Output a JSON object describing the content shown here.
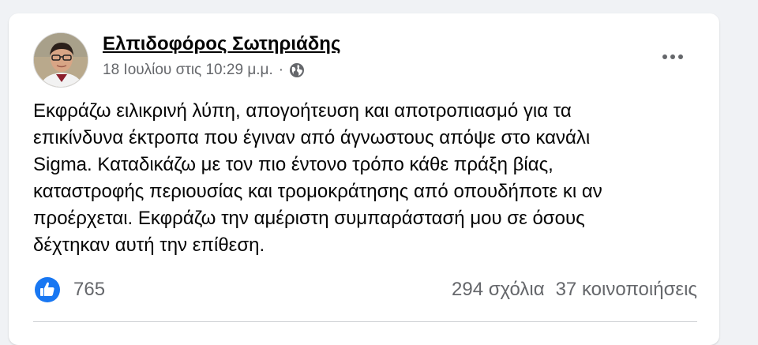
{
  "post": {
    "author": "Ελπιδοφόρος Σωτηριάδης",
    "timestamp": "18 Ιουλίου στις 10:29 μ.μ.",
    "separator": "·",
    "privacy_icon": "globe-icon",
    "more_icon": "more-options-icon",
    "text_lines": [
      "Εκφράζω ειλικρινή λύπη, απογοήτευση και αποτροπιασμό για τα",
      "επικίνδυνα έκτροπα που έγιναν από άγνωστους απόψε στο κανάλι",
      "Sigma. Καταδικάζω με τον πιο έντονο τρόπο κάθε πράξη βίας,",
      "καταστροφής περιουσίας και τρομοκράτησης από οπουδήποτε κι αν",
      "προέρχεται. Εκφράζω την αμέριστη συμπαράστασή μου σε όσους",
      "δέχτηκαν αυτή την επίθεση."
    ],
    "reactions": {
      "icon": "like-icon",
      "count": "765"
    },
    "comments": "294 σχόλια",
    "shares": "37 κοινοποιήσεις"
  },
  "colors": {
    "page_background": "#f0f2f5",
    "card_background": "#ffffff",
    "primary_text": "#050505",
    "secondary_text": "#65676b",
    "like_blue": "#1877f2"
  }
}
